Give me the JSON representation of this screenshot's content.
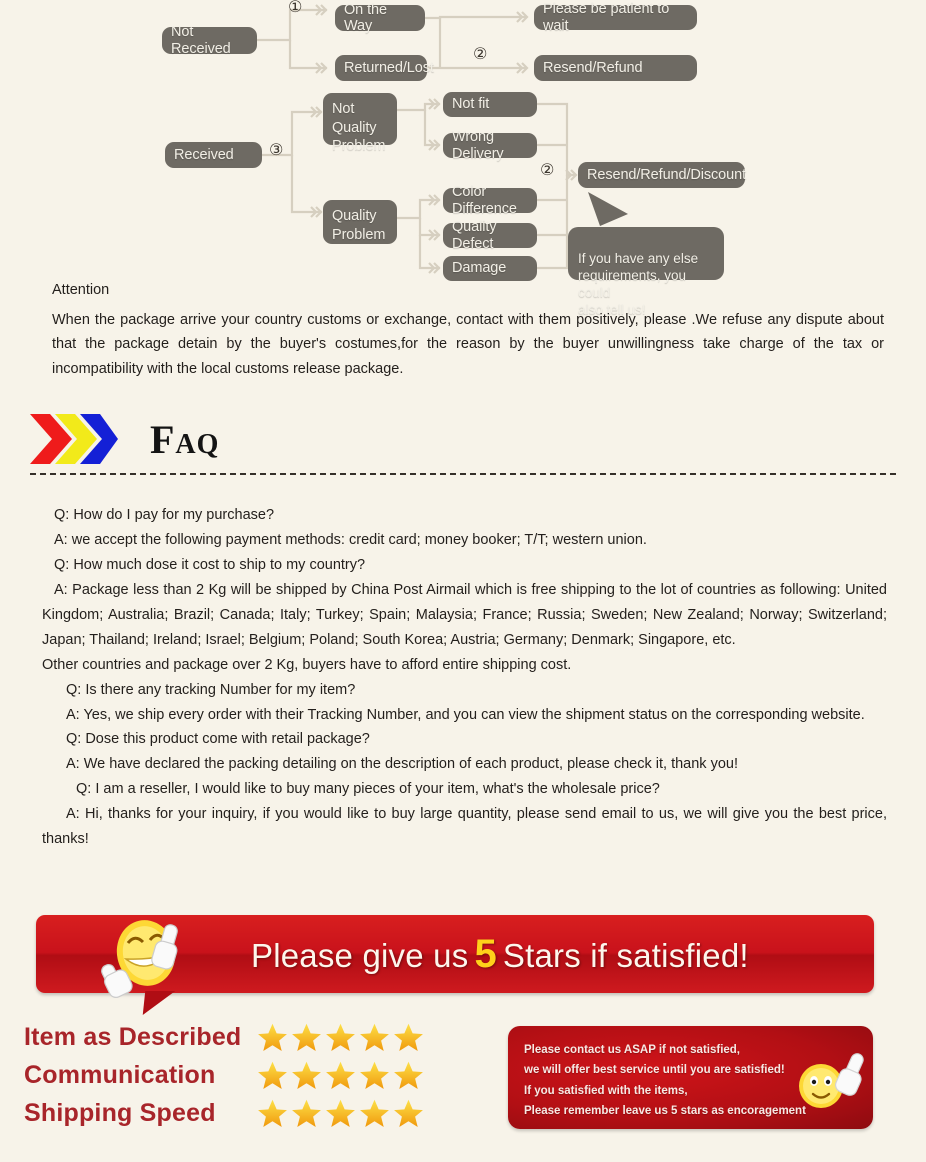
{
  "theme": {
    "page_bg": "#f7f3e9",
    "node_bg": "#6e6a63",
    "node_text": "#f2efe6",
    "connector": "#cdc6b8",
    "banner_red": "#c9121b",
    "note_red": "#b20f14",
    "star_gold": "#f5a623",
    "rating_label": "#a8252a",
    "chevron_red": "#ef1b1b",
    "chevron_yellow": "#f2ea1a",
    "chevron_blue": "#1420d6"
  },
  "flowchart": {
    "nodes": {
      "not_received": "Not Received",
      "on_the_way": "On the Way",
      "returned_lost": "Returned/Lost",
      "please_wait": "Please be patient to wait",
      "resend_refund": "Resend/Refund",
      "received": "Received",
      "not_quality_problem": "Not\nQuality\nProblem",
      "quality_problem": "Quality\nProblem",
      "not_fit": "Not fit",
      "wrong_delivery": "Wrong Delivery",
      "color_difference": "Color Difference",
      "quality_defect": "Quality Defect",
      "damage": "Damage",
      "resend_refund_discount": "Resend/Refund/Discount"
    },
    "markers": {
      "one": "①",
      "two_top": "②",
      "three": "③",
      "two_bottom": "②"
    },
    "callout": "If you have any else\nrequirements, you could\nalso tell us!"
  },
  "attention": {
    "title": "Attention",
    "body": "When the package arrive your country customs or exchange, contact with them positively, please .We refuse any dispute about that the package detain by the buyer's costumes,for the reason by the buyer unwillingness take charge of the tax or incompatibility with the local customs release package."
  },
  "faq": {
    "title": "Faq",
    "lines": [
      {
        "indent": 0,
        "text": "Q: How do I pay for my purchase?"
      },
      {
        "indent": 1,
        "text": "A: we accept the following payment methods: credit card; money booker; T/T; western union."
      },
      {
        "indent": 1,
        "text": "Q: How much dose it cost to ship to my country?"
      },
      {
        "indent": 1,
        "text": "A: Package less than 2 Kg will be shipped by China Post Airmail which is free shipping to the lot of countries as following: United Kingdom; Australia; Brazil; Canada; Italy; Turkey; Spain; Malaysia; France; Russia; Sweden; New Zealand; Norway; Switzerland; Japan; Thailand; Ireland; Israel; Belgium; Poland; South Korea; Austria; Germany; Denmark; Singapore, etc."
      },
      {
        "indent": 0,
        "text": "Other countries and package over 2 Kg, buyers have to afford entire shipping cost."
      },
      {
        "indent": 1,
        "text": "Q: Is there any tracking Number for my item?"
      },
      {
        "indent": 1,
        "text": "A: Yes, we ship every order with their Tracking Number, and you can view the shipment status on the corresponding website."
      },
      {
        "indent": 1,
        "text": "Q: Dose this product come with retail package?"
      },
      {
        "indent": 1,
        "text": "A: We have declared the packing detailing on the description of each product, please check it, thank you!"
      },
      {
        "indent": 2,
        "text": "Q: I am a reseller, I would like to buy many pieces of your item, what's the wholesale price?"
      },
      {
        "indent": 1,
        "text": "A: Hi, thanks for your inquiry, if you would like to buy large quantity, please send email to us, we will give you the best price, thanks!"
      }
    ]
  },
  "banner": {
    "text_before": "Please give us",
    "five": "5",
    "text_after": "Stars if satisfied!"
  },
  "ratings": [
    {
      "label": "Item as Described",
      "stars": 5
    },
    {
      "label": "Communication",
      "stars": 5
    },
    {
      "label": "Shipping Speed",
      "stars": 5
    }
  ],
  "note": {
    "lines": [
      "Please contact us ASAP if not satisfied,",
      "we will offer best service until you are satisfied!",
      "If you satisfied with the items,",
      "Please remember leave us 5 stars as encoragement"
    ]
  }
}
